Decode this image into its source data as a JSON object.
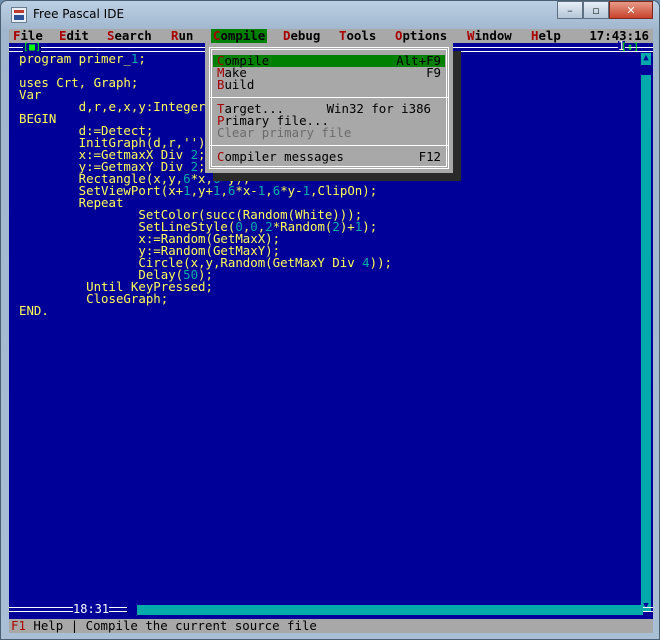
{
  "window": {
    "title": "Free Pascal IDE"
  },
  "caption": {
    "minimize": "–",
    "maximize": "▫",
    "close": "✕"
  },
  "menubar": {
    "items": [
      {
        "hotkey": "F",
        "rest": "ile"
      },
      {
        "hotkey": "E",
        "rest": "dit"
      },
      {
        "hotkey": "S",
        "rest": "earch"
      },
      {
        "hotkey": "R",
        "rest": "un"
      },
      {
        "hotkey": "C",
        "rest": "ompile"
      },
      {
        "hotkey": "D",
        "rest": "ebug"
      },
      {
        "hotkey": "T",
        "rest": "ools"
      },
      {
        "hotkey": "O",
        "rest": "ptions"
      },
      {
        "hotkey": "W",
        "rest": "indow"
      },
      {
        "hotkey": "H",
        "rest": "elp"
      }
    ],
    "clock": "17:43:16"
  },
  "editor": {
    "close_box": "[■]",
    "window_number": "1",
    "zoom_box": "[↕]",
    "cursor_position": "18:31",
    "lines": [
      "program primer_1;",
      "",
      "uses Crt, Graph;",
      "Var",
      "        d,r,e,x,y:Integer;",
      "BEGIN",
      "        d:=Detect;",
      "        InitGraph(d,r,'');",
      "        x:=GetmaxX Div 2;",
      "        y:=GetmaxY Div 2;",
      "        Rectangle(x,y,6*x,6*y);",
      "        SetViewPort(x+1,y+1,6*x-1,6*y-1,ClipOn);",
      "        Repeat",
      "                SetColor(succ(Random(White)));",
      "                SetLineStyle(0,0,2*Random(2)+1);",
      "                x:=Random(GetMaxX);",
      "                y:=Random(GetMaxY);",
      "                Circle(x,y,Random(GetMaxY Div 4));",
      "                Delay(50);",
      "         Until KeyPressed;",
      "         CloseGraph;",
      "END."
    ]
  },
  "compile_menu": {
    "items": [
      {
        "hotkey": "C",
        "rest": "ompile",
        "shortcut": "Alt+F9",
        "state": "selected"
      },
      {
        "hotkey": "M",
        "rest": "ake",
        "shortcut": "F9",
        "state": "normal"
      },
      {
        "hotkey": "B",
        "rest": "uild",
        "shortcut": "",
        "state": "normal"
      },
      {
        "hotkey": "T",
        "rest": "arget...",
        "shortcut": "Win32 for i386",
        "state": "normal"
      },
      {
        "hotkey": "P",
        "rest": "rimary file...",
        "shortcut": "",
        "state": "normal"
      },
      {
        "hotkey": "",
        "rest": "Clear primary file",
        "shortcut": "",
        "state": "disabled"
      },
      {
        "hotkey": "C",
        "rest": "ompiler messages",
        "shortcut": "F12",
        "state": "normal"
      }
    ]
  },
  "statusbar": {
    "key": "F1",
    "key_label": "Help",
    "separator": "|",
    "message": "Compile the current source file"
  }
}
